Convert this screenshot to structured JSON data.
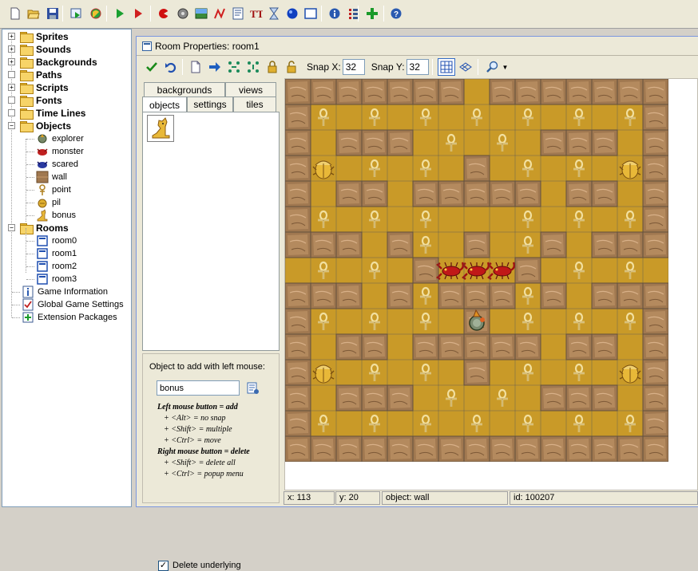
{
  "toolbar": {
    "icons": [
      "new-file-icon",
      "open-folder-icon",
      "save-icon",
      "export-exe-icon",
      "publish-icon",
      "run-icon",
      "debug-icon",
      "sprite-icon",
      "sound-icon",
      "background-icon",
      "path-icon",
      "script-icon",
      "font-icon",
      "timeline-icon",
      "object-icon",
      "room-icon",
      "game-info-icon",
      "game-settings-icon",
      "extension-icon",
      "help-icon"
    ]
  },
  "tree": {
    "folders": [
      {
        "label": "Sprites"
      },
      {
        "label": "Sounds"
      },
      {
        "label": "Backgrounds"
      },
      {
        "label": "Paths"
      },
      {
        "label": "Scripts"
      },
      {
        "label": "Fonts"
      },
      {
        "label": "Time Lines"
      },
      {
        "label": "Objects"
      }
    ],
    "objects": [
      {
        "label": "explorer",
        "icon": "explorer-icon"
      },
      {
        "label": "monster",
        "icon": "monster-icon"
      },
      {
        "label": "scared",
        "icon": "scared-icon"
      },
      {
        "label": "wall",
        "icon": "wall-icon"
      },
      {
        "label": "point",
        "icon": "point-icon"
      },
      {
        "label": "pil",
        "icon": "pil-icon"
      },
      {
        "label": "bonus",
        "icon": "bonus-icon"
      }
    ],
    "rooms_folder": {
      "label": "Rooms"
    },
    "rooms": [
      {
        "label": "room0"
      },
      {
        "label": "room1"
      },
      {
        "label": "room2"
      },
      {
        "label": "room3"
      }
    ],
    "extras": [
      {
        "label": "Game Information",
        "icon": "info-icon"
      },
      {
        "label": "Global Game Settings",
        "icon": "settings-icon"
      },
      {
        "label": "Extension Packages",
        "icon": "extension-icon"
      }
    ]
  },
  "window": {
    "title": "Room Properties: room1",
    "snap_x_label": "Snap X:",
    "snap_x_value": "32",
    "snap_y_label": "Snap Y:",
    "snap_y_value": "32"
  },
  "tabs": {
    "top": [
      {
        "label": "backgrounds"
      },
      {
        "label": "views"
      }
    ],
    "bottom": [
      {
        "label": "objects"
      },
      {
        "label": "settings"
      },
      {
        "label": "tiles"
      }
    ],
    "active": "objects"
  },
  "add_panel": {
    "label": "Object to add with left mouse:",
    "object_value": "bonus",
    "help": [
      "Left mouse button = add",
      "+ <Alt> = no snap",
      "+ <Shift> = multiple",
      "+ <Ctrl> = move",
      "Right mouse button = delete",
      "+ <Shift> = delete all",
      "+ <Ctrl> = popup menu"
    ],
    "delete_underlying_label": "Delete underlying",
    "delete_underlying_checked": true
  },
  "status": {
    "x": "x: 113",
    "y": "y: 20",
    "object": "object: wall",
    "id": "id: 100207"
  },
  "room": {
    "cols": 15,
    "rows": 15,
    "colors": {
      "floor": "#c99a28",
      "wall": "#a07850"
    },
    "grid": [
      "WWWWWWW.WWWWWWW",
      "WA.A.A.A.A.A.AW",
      "W.WWW.A.A.WWW.W",
      "WB.A.A.W.A.A.BW",
      "W.WW.WWWWW.WW.W",
      "WA.A.A...A.A.AW",
      "WWW.WA.W.AW.WWW",
      ".A.A.W...W.A.A.",
      "WWW.WAWWWAW.WWW",
      "WA.A.A.W.A.A.AW",
      "W.WW.WWWWW.WW.W",
      "WB.A.A.W.A.A.BW",
      "W.WWW.A.A.WWW.W",
      "WA.A.A.A.A.A.AW",
      "WWWWWWWWWWWWWWW"
    ],
    "monsters": [
      [
        6,
        7
      ],
      [
        7,
        7
      ],
      [
        8,
        7
      ]
    ],
    "explorer": [
      7,
      9
    ]
  }
}
